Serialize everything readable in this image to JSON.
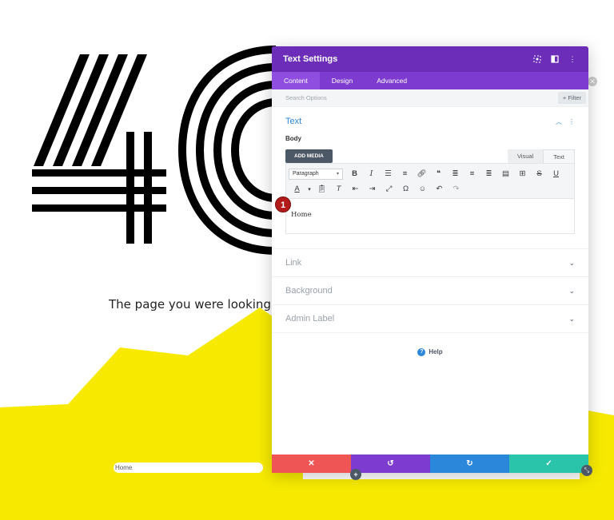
{
  "background": {
    "tagline": "The page you were looking",
    "home_field_value": "Home",
    "colors": {
      "yellow": "#f7ea00",
      "black": "#000000"
    }
  },
  "modal": {
    "title": "Text Settings",
    "header_icons": [
      "target-icon",
      "split-view-icon",
      "more-options-icon"
    ],
    "tabs": [
      "Content",
      "Design",
      "Advanced"
    ],
    "active_tab": "Content",
    "search_placeholder": "Search Options",
    "filter_label": "+ Filter",
    "open_section": {
      "title": "Text",
      "body_label": "Body",
      "add_media_label": "ADD MEDIA",
      "editor_tabs": [
        "Visual",
        "Text"
      ],
      "active_editor_tab": "Text",
      "format_select": "Paragraph",
      "content_text": "Home",
      "marker_number": "1"
    },
    "collapsed_sections": [
      "Link",
      "Background",
      "Admin Label"
    ],
    "help_label": "Help",
    "colors": {
      "header": "#6c2eb9",
      "tabs": "#7d3bcf",
      "accent_blue": "#2b87da",
      "cancel": "#ef5555",
      "undo": "#7d3bcf",
      "redo": "#2b87da",
      "save": "#29c4a9"
    }
  }
}
